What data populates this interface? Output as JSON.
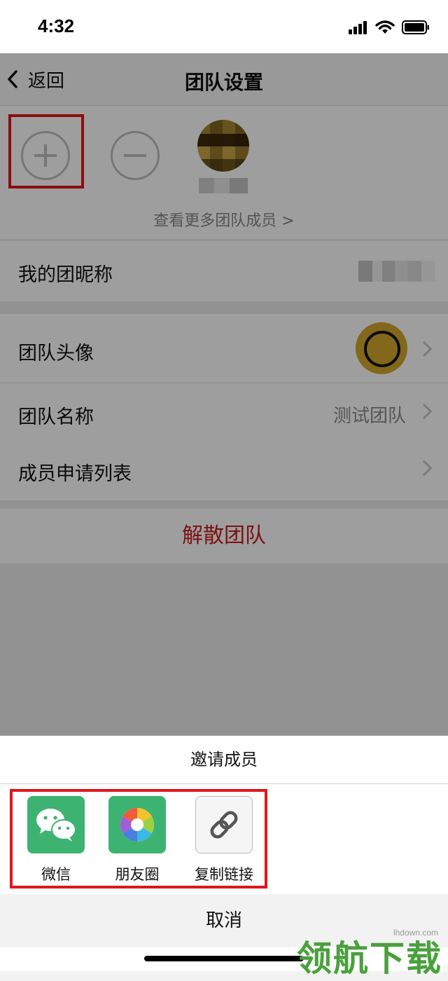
{
  "status_bar": {
    "time": "4:32"
  },
  "nav": {
    "back_label": "返回",
    "title": "团队设置"
  },
  "members": {
    "more_link": "查看更多团队成员 >"
  },
  "settings": {
    "nickname_label": "我的团昵称",
    "avatar_label": "团队头像",
    "name_label": "团队名称",
    "name_value": "测试团队",
    "applications_label": "成员申请列表"
  },
  "dissolve_label": "解散团队",
  "share_sheet": {
    "title": "邀请成员",
    "options": [
      {
        "label": "微信",
        "icon": "wechat-icon",
        "color": "#3cb371"
      },
      {
        "label": "朋友圈",
        "icon": "moments-icon",
        "color": "#3cb371"
      },
      {
        "label": "复制链接",
        "icon": "link-icon",
        "color": "#f5f5f5"
      }
    ],
    "cancel_label": "取消"
  },
  "watermark": {
    "text": "领航下载",
    "url": "lhdown.com"
  },
  "colors": {
    "accent_red": "#e0161b",
    "danger_text": "#c81e1e",
    "wechat_green": "#3cb371"
  }
}
